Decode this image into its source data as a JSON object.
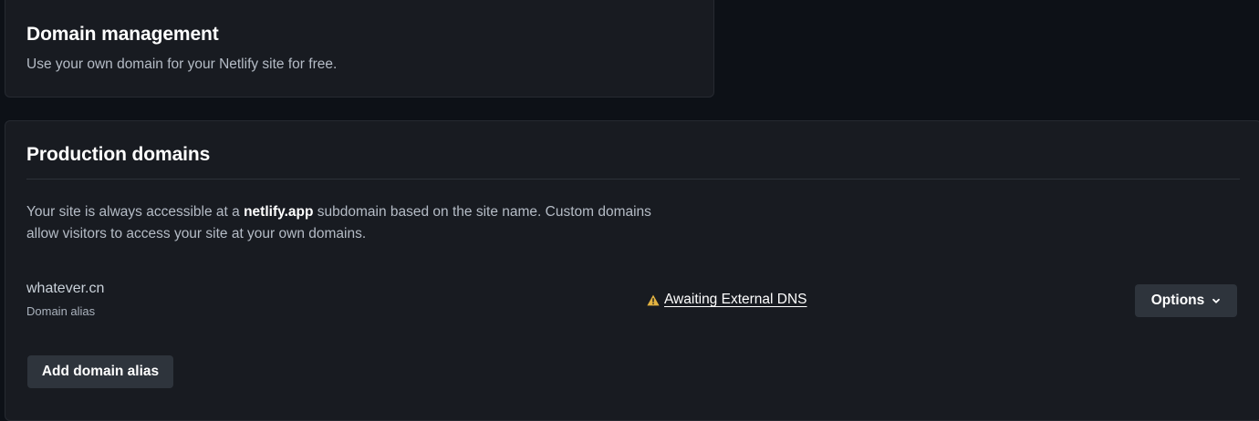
{
  "domain_management": {
    "title": "Domain management",
    "description": "Use your own domain for your Netlify site for free."
  },
  "production_domains": {
    "title": "Production domains",
    "description_before": "Your site is always accessible at a ",
    "description_bold": "netlify.app",
    "description_after": " subdomain based on the site name. Custom domains allow visitors to access your site at your own domains.",
    "domain": {
      "name": "whatever.cn",
      "type": "Domain alias",
      "status": "Awaiting External DNS",
      "status_icon": "warning-triangle-icon",
      "status_color": "#e3b341"
    },
    "options_label": "Options",
    "add_alias_label": "Add domain alias"
  }
}
